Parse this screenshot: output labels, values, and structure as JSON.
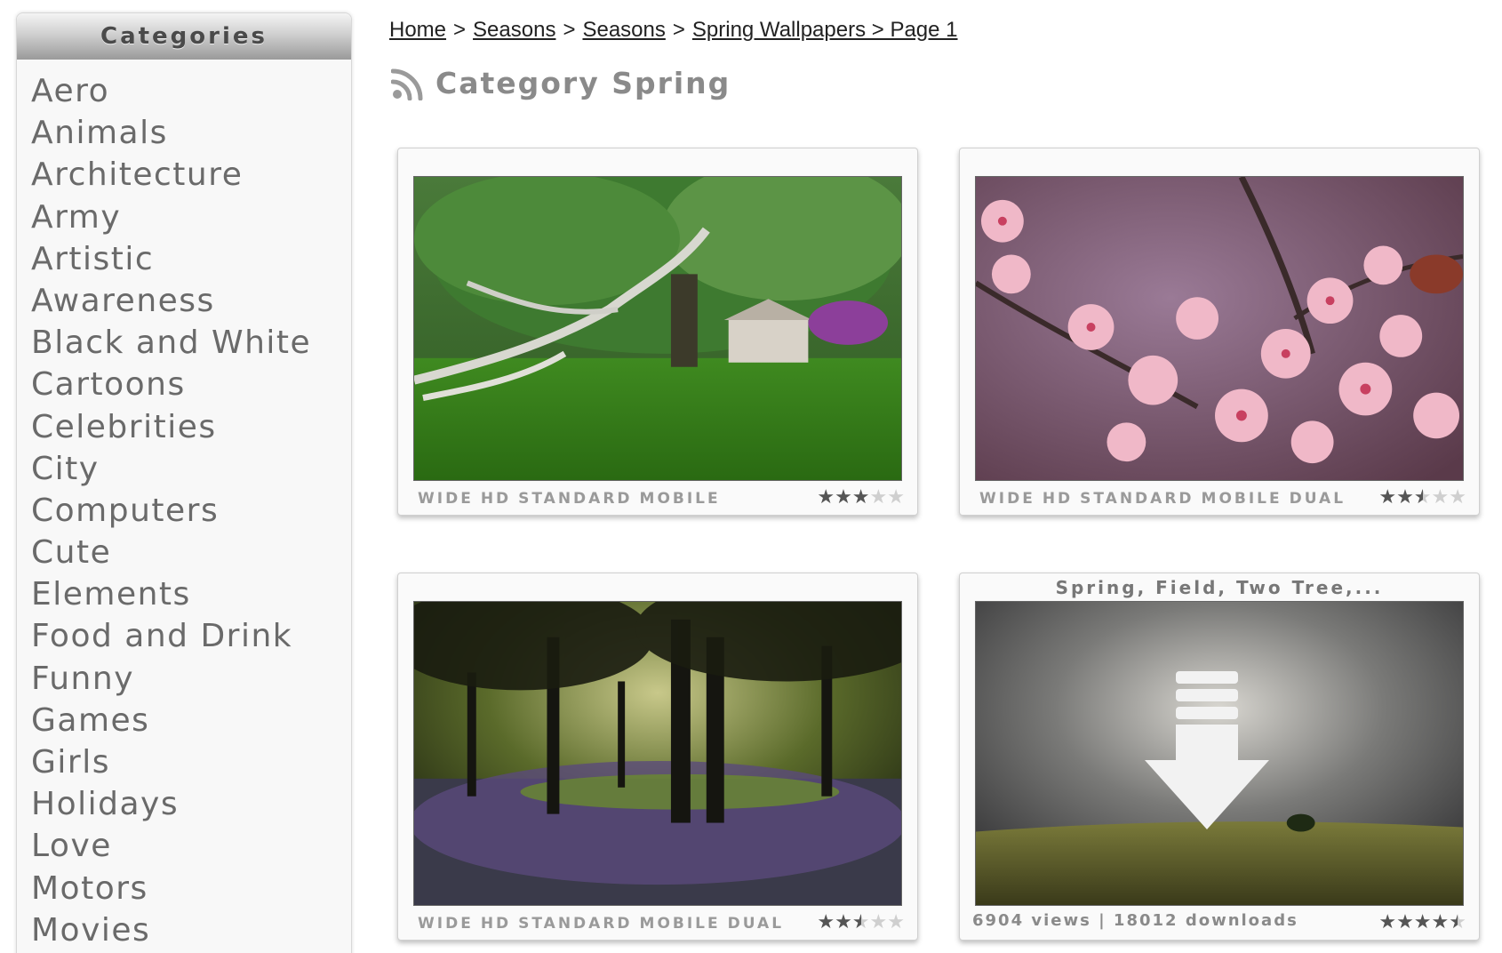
{
  "sidebar": {
    "title": "Categories",
    "items": [
      "Aero",
      "Animals",
      "Architecture",
      "Army",
      "Artistic",
      "Awareness",
      "Black and White",
      "Cartoons",
      "Celebrities",
      "City",
      "Computers",
      "Cute",
      "Elements",
      "Food and Drink",
      "Funny",
      "Games",
      "Girls",
      "Holidays",
      "Love",
      "Motors",
      "Movies"
    ]
  },
  "breadcrumb": {
    "items": [
      "Home",
      "Seasons",
      "Seasons",
      "Spring Wallpapers > Page 1"
    ],
    "separator": ">"
  },
  "page": {
    "title": "Category Spring",
    "icon": "rss-icon"
  },
  "cards": [
    {
      "formats": [
        "WIDE",
        "HD",
        "STANDARD",
        "MOBILE"
      ],
      "rating": 3,
      "scene": "tree-house"
    },
    {
      "formats": [
        "WIDE",
        "HD",
        "STANDARD",
        "MOBILE",
        "DUAL"
      ],
      "rating": 2.5,
      "scene": "cherry-blossom"
    },
    {
      "formats": [
        "WIDE",
        "HD",
        "STANDARD",
        "MOBILE",
        "DUAL"
      ],
      "rating": 2.5,
      "scene": "forest-bluebells"
    },
    {
      "title": "Spring, Field, Two Tree,...",
      "stats": "6904 views | 18012 downloads",
      "rating": 4.5,
      "scene": "storm-field-download"
    }
  ],
  "colors": {
    "accent_text": "#8a8a8a",
    "link": "#222222",
    "star_on": "#555555",
    "star_off": "#cfcfcf"
  }
}
